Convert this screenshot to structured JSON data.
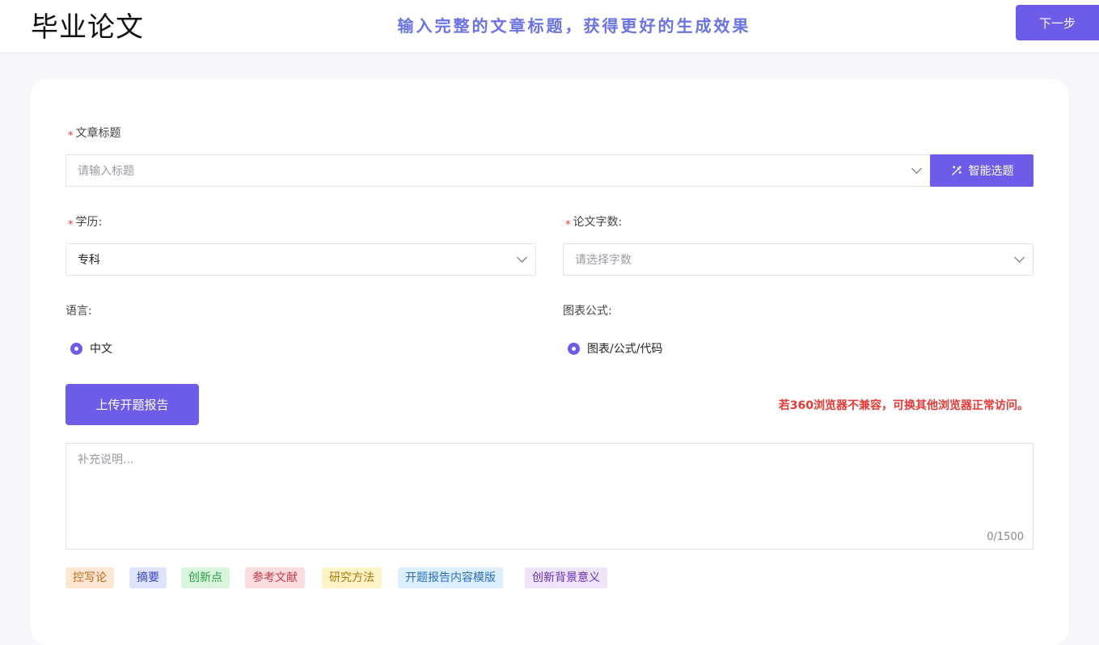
{
  "header": {
    "title": "毕业论文",
    "tagline": "输入完整的文章标题，获得更好的生成效果",
    "next_label": "下一步"
  },
  "form": {
    "title_field": {
      "label": "文章标题",
      "required_mark": "*",
      "placeholder": "请输入标题",
      "smart_button": "智能选题"
    },
    "education": {
      "label": "学历:",
      "required_mark": "*",
      "value": "专科"
    },
    "word_count": {
      "label": "论文字数:",
      "required_mark": "*",
      "placeholder": "请选择字数"
    },
    "language": {
      "label": "语言:",
      "option": "中文"
    },
    "charts": {
      "label": "图表公式:",
      "option": "图表/公式/代码"
    },
    "upload_label": "上传开题报告",
    "warning": "若360浏览器不兼容，可换其他浏览器正常访问。",
    "notes": {
      "placeholder": "补充说明...",
      "counter": "0/1500"
    }
  },
  "tags": [
    {
      "label": "控写论",
      "bg": "#fde7d2",
      "fg": "#c26a1a"
    },
    {
      "label": "摘要",
      "bg": "#dfe3fb",
      "fg": "#3446c9"
    },
    {
      "label": "创新点",
      "bg": "#d9f6dd",
      "fg": "#2c9a43"
    },
    {
      "label": "参考文献",
      "bg": "#fbdde0",
      "fg": "#c83a47"
    },
    {
      "label": "研究方法",
      "bg": "#fdf3c7",
      "fg": "#a77a0b"
    },
    {
      "label": "开题报告内容模版",
      "bg": "#dcefff",
      "fg": "#2a6cc0"
    },
    {
      "label": "创新背景意义",
      "bg": "#eee4fb",
      "fg": "#6a2bb8"
    }
  ],
  "colors": {
    "accent": "#6c5ce7",
    "tagline": "#6a72e6",
    "warning": "#e53935"
  }
}
